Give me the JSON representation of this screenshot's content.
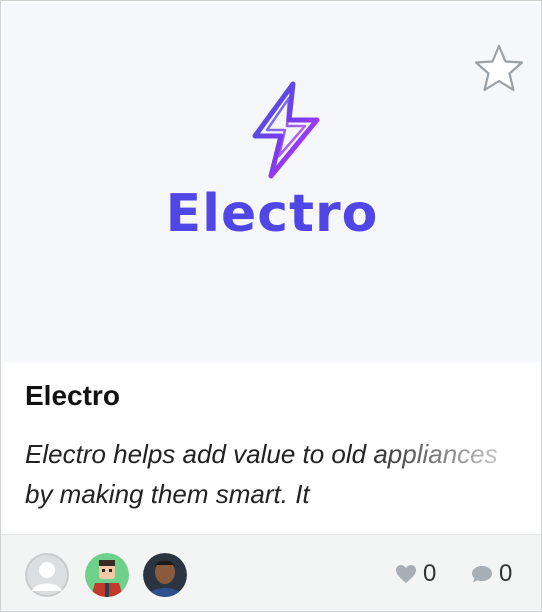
{
  "card": {
    "title": "Electro",
    "description": "Electro helps add value to old appliances by making them smart. It",
    "logo_text": "Electro",
    "brand_color": "#4f46e5",
    "favorite_icon": "star-outline-icon"
  },
  "footer": {
    "avatars": [
      {
        "name": "default-avatar",
        "icon": "user-silhouette"
      },
      {
        "name": "cartoon-avatar",
        "icon": "cartoon-person"
      },
      {
        "name": "photo-avatar",
        "icon": "person-photo"
      }
    ],
    "likes": "0",
    "comments": "0",
    "like_icon": "heart-icon",
    "comment_icon": "comment-bubble-icon"
  }
}
